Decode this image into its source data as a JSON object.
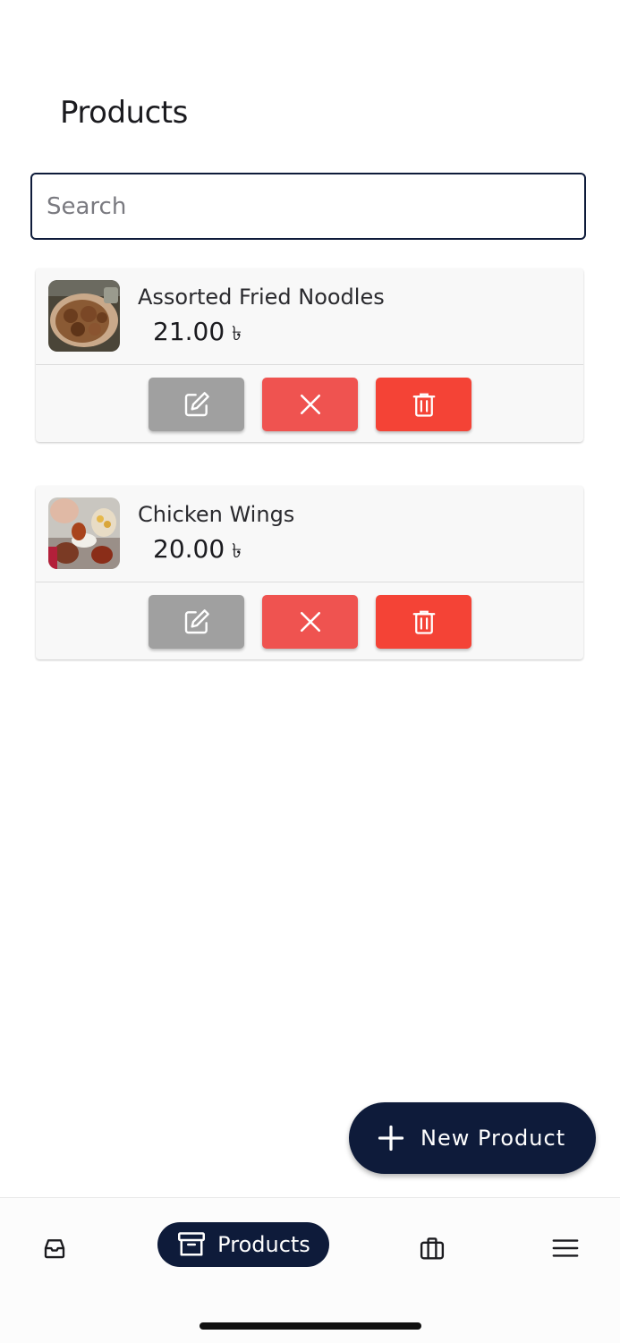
{
  "header": {
    "title": "Products"
  },
  "search": {
    "placeholder": "Search",
    "value": ""
  },
  "products": [
    {
      "name": "Assorted Fried Noodles",
      "price": "21.00",
      "currency": "৳",
      "image": "fried-noodles-photo",
      "actions": {
        "edit_icon": "edit-icon",
        "cancel_icon": "close-icon",
        "delete_icon": "trash-icon"
      }
    },
    {
      "name": "Chicken Wings",
      "price": "20.00",
      "currency": "৳",
      "image": "chicken-wings-photo",
      "actions": {
        "edit_icon": "edit-icon",
        "cancel_icon": "close-icon",
        "delete_icon": "trash-icon"
      }
    }
  ],
  "fab": {
    "label": "New Product",
    "icon": "plus-icon"
  },
  "bottom_nav": {
    "items": [
      {
        "icon": "inbox-icon",
        "label": ""
      },
      {
        "icon": "archive-icon",
        "label": "Products",
        "active": true
      },
      {
        "icon": "briefcase-icon",
        "label": ""
      },
      {
        "icon": "menu-icon",
        "label": ""
      }
    ]
  },
  "colors": {
    "primary": "#0e1b3a",
    "edit_button": "#a0a0a0",
    "cancel_button": "#ef5350",
    "delete_button": "#f44336",
    "card_background": "#f8f8f8"
  }
}
